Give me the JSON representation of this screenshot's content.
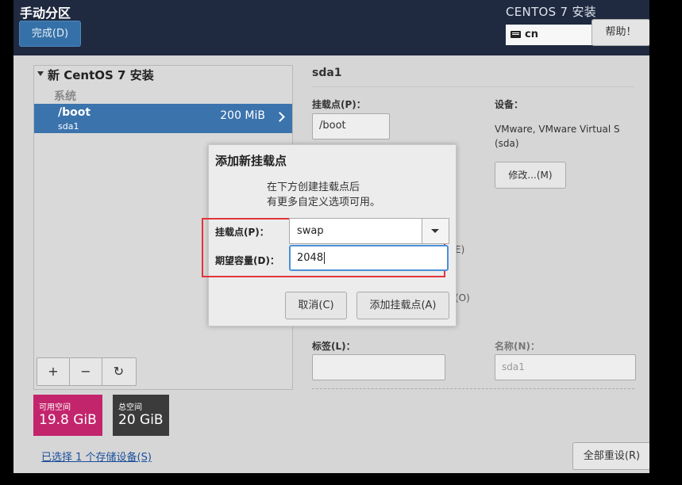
{
  "header": {
    "title": "手动分区",
    "done_label": "完成(D)",
    "install_title": "CENTOS 7 安装",
    "keyboard_layout": "cn",
    "help_label": "帮助！"
  },
  "left_panel": {
    "tree_title": "新 CentOS 7 安装",
    "group_label": "系统",
    "mount_points": [
      {
        "name": "/boot",
        "device": "sda1",
        "size": "200 MiB"
      }
    ],
    "toolbar": {
      "add": "+",
      "remove": "−",
      "refresh": "↻"
    }
  },
  "space": {
    "available_label": "可用空间",
    "available_value": "19.8 GiB",
    "available_color": "#c3256c",
    "total_label": "总空间",
    "total_value": "20 GiB",
    "total_color": "#3b3b3b"
  },
  "storage_link": "已选择 1 个存储设备(S)",
  "right_panel": {
    "title": "sda1",
    "mount_point_label": "挂载点(P)：",
    "mount_point_value": "/boot",
    "device_label": "设备：",
    "device_value": "VMware, VMware Virtual S (sda)",
    "modify_label": "修改...(M)",
    "partial_e": "E)",
    "partial_o": "(O)",
    "tag_label": "标签(L)：",
    "tag_value": "",
    "name_label": "名称(N)：",
    "name_value": "sda1",
    "reset_label": "全部重设(R)"
  },
  "dialog": {
    "title": "添加新挂载点",
    "desc_line1": "在下方创建挂载点后",
    "desc_line2": "有更多自定义选项可用。",
    "mount_label": "挂载点(P)：",
    "mount_value": "swap",
    "capacity_label": "期望容量(D)：",
    "capacity_value": "2048",
    "cancel_label": "取消(C)",
    "add_label": "添加挂载点(A)"
  }
}
